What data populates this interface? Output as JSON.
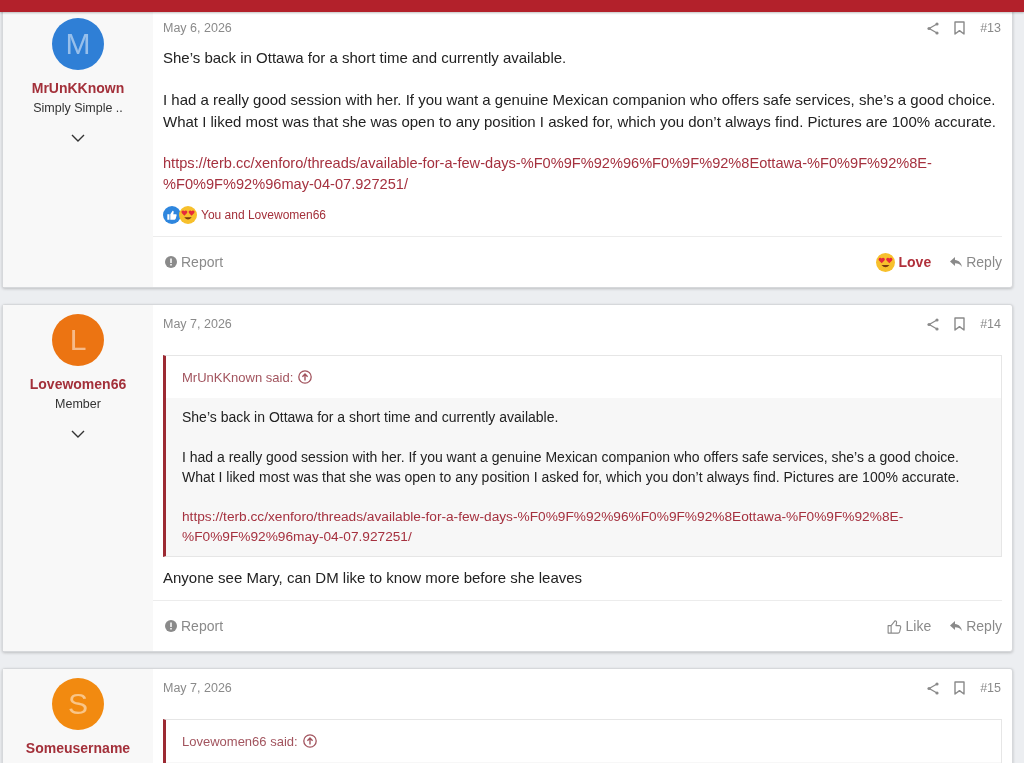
{
  "posts": [
    {
      "author": {
        "initial": "M",
        "color": "#2f7fd6",
        "name": "MrUnKKnown",
        "title": "Simply Simple .."
      },
      "date": "May 6, 2026",
      "number": "#13",
      "body": [
        {
          "kind": "text",
          "text": "She’s back in Ottawa for a short time and currently available."
        },
        {
          "kind": "text",
          "text": "I had a really good session with her. If you want a genuine Mexican companion who offers safe services, she’s a good choice.\nWhat I liked most was that she was open to any position I asked for, which you don’t always find. Pictures are 100% accurate."
        },
        {
          "kind": "link",
          "text": "https://terb.cc/xenforo/threads/available-for-a-few-days-%F0%9F%92%96%F0%9F%92%8Eottawa-%F0%9F%92%8E-%F0%9F%92%96may-04-07.927251/"
        }
      ],
      "reactions": {
        "icons": [
          {
            "kind": "like"
          },
          {
            "kind": "love"
          }
        ],
        "summary": "You and Lovewomen66"
      },
      "footer": {
        "report": "Report",
        "react": {
          "kind": "love",
          "label": "Love",
          "selected": true
        },
        "reply": "Reply"
      }
    },
    {
      "author": {
        "initial": "L",
        "color": "#ec7412",
        "name": "Lovewomen66",
        "title": "Member"
      },
      "date": "May 7, 2026",
      "number": "#14",
      "quote": {
        "attribution": "MrUnKKnown said:",
        "body": [
          {
            "kind": "text",
            "text": "She’s back in Ottawa for a short time and currently available."
          },
          {
            "kind": "text",
            "text": "I had a really good session with her. If you want a genuine Mexican companion who offers safe services, she’s a good choice.\nWhat I liked most was that she was open to any position I asked for, which you don’t always find. Pictures are 100% accurate."
          },
          {
            "kind": "link",
            "text": "https://terb.cc/xenforo/threads/available-for-a-few-days-%F0%9F%92%96%F0%9F%92%8Eottawa-%F0%9F%92%8E-%F0%9F%92%96may-04-07.927251/"
          }
        ]
      },
      "body": [
        {
          "kind": "text",
          "text": "Anyone see Mary, can DM like to know more before she leaves"
        }
      ],
      "footer": {
        "report": "Report",
        "react": {
          "kind": "like",
          "label": "Like",
          "selected": false
        },
        "reply": "Reply"
      }
    },
    {
      "author": {
        "initial": "S",
        "color": "#f28a10",
        "name": "Someusername"
      },
      "date": "May 7, 2026",
      "number": "#15",
      "quote": {
        "attribution": "Lovewomen66 said:"
      }
    }
  ]
}
